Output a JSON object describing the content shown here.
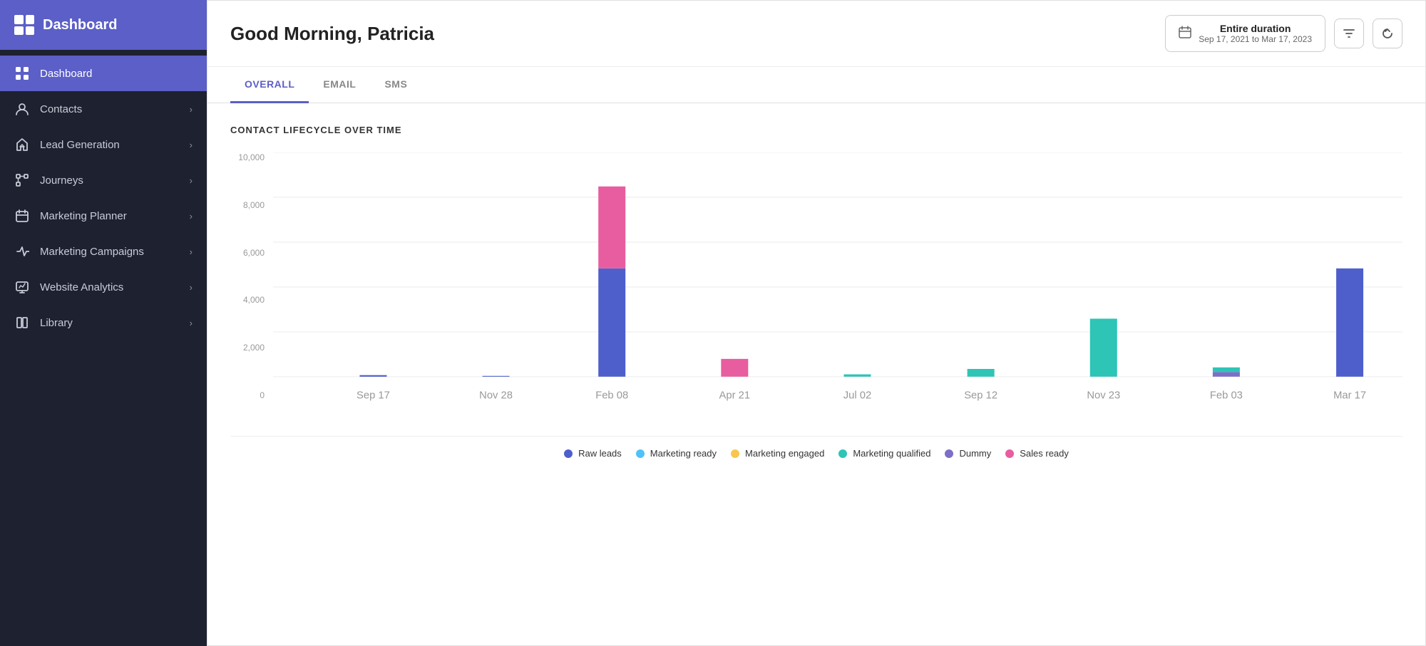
{
  "sidebar": {
    "logo": {
      "text": "Dashboard"
    },
    "items": [
      {
        "id": "dashboard",
        "label": "Dashboard",
        "active": true
      },
      {
        "id": "contacts",
        "label": "Contacts",
        "active": false
      },
      {
        "id": "lead-generation",
        "label": "Lead Generation",
        "active": false
      },
      {
        "id": "journeys",
        "label": "Journeys",
        "active": false
      },
      {
        "id": "marketing-planner",
        "label": "Marketing Planner",
        "active": false
      },
      {
        "id": "marketing-campaigns",
        "label": "Marketing Campaigns",
        "active": false
      },
      {
        "id": "website-analytics",
        "label": "Website Analytics",
        "active": false
      },
      {
        "id": "library",
        "label": "Library",
        "active": false
      }
    ]
  },
  "header": {
    "greeting": "Good Morning, Patricia",
    "date_range": {
      "label": "Entire duration",
      "from": "Sep 17, 2021",
      "to": "Mar 17, 2023",
      "display": "Sep 17, 2021  to  Mar 17, 2023"
    }
  },
  "tabs": [
    {
      "id": "overall",
      "label": "OVERALL",
      "active": true
    },
    {
      "id": "email",
      "label": "EMAIL",
      "active": false
    },
    {
      "id": "sms",
      "label": "SMS",
      "active": false
    }
  ],
  "chart": {
    "title": "CONTACT LIFECYCLE OVER TIME",
    "y_labels": [
      "10,000",
      "8,000",
      "6,000",
      "4,000",
      "2,000",
      "0"
    ],
    "x_labels": [
      "Sep 17",
      "Nov 28",
      "Feb 08",
      "Apr 21",
      "Jul 02",
      "Sep 12",
      "Nov 23",
      "Feb 03",
      "Mar 17"
    ],
    "legend": [
      {
        "label": "Raw leads",
        "color": "#4e5fcc"
      },
      {
        "label": "Marketing ready",
        "color": "#4fc3f7"
      },
      {
        "label": "Marketing engaged",
        "color": "#f9c74f"
      },
      {
        "label": "Marketing qualified",
        "color": "#2ec4b6"
      },
      {
        "label": "Dummy",
        "color": "#7c6fc7"
      },
      {
        "label": "Sales ready",
        "color": "#e85d9f"
      }
    ]
  },
  "icons": {
    "calendar": "📅",
    "filter": "⊿",
    "refresh": "↺"
  }
}
